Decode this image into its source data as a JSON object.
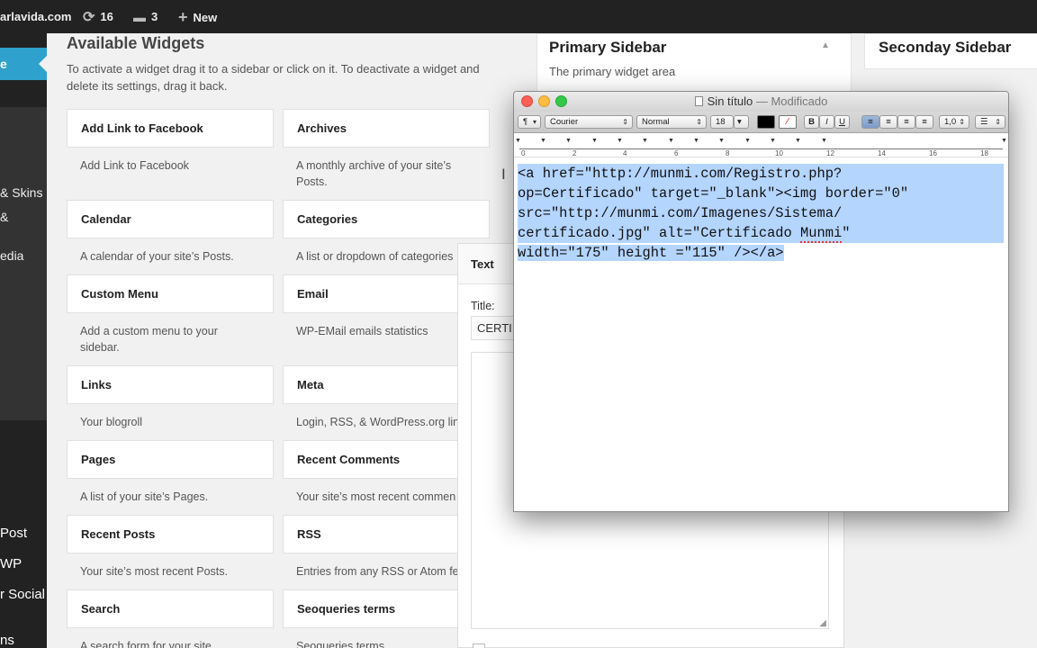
{
  "adminbar": {
    "site": "arlavida.com",
    "updates_count": "16",
    "comments_count": "3",
    "new_label": "New"
  },
  "leftmenu": {
    "current": "e",
    "items": [
      "& Skins",
      "&",
      "edia",
      "Post",
      "WP",
      "r Social",
      "ns"
    ]
  },
  "available": {
    "title": "Available Widgets",
    "description": "To activate a widget drag it to a sidebar or click on it. To deactivate a widget and delete its settings, drag it back."
  },
  "widgets": [
    {
      "name": "Add Link to Facebook",
      "desc": "Add Link to Facebook"
    },
    {
      "name": "Archives",
      "desc": "A monthly archive of your site’s Posts."
    },
    {
      "name": "Calendar",
      "desc": "A calendar of your site’s Posts."
    },
    {
      "name": "Categories",
      "desc": "A list or dropdown of categories"
    },
    {
      "name": "Custom Menu",
      "desc": "Add a custom menu to your sidebar."
    },
    {
      "name": "Email",
      "desc": "WP-EMail emails statistics"
    },
    {
      "name": "Links",
      "desc": "Your blogroll"
    },
    {
      "name": "Meta",
      "desc": "Login, RSS, & WordPress.org link"
    },
    {
      "name": "Pages",
      "desc": "A list of your site’s Pages."
    },
    {
      "name": "Recent Comments",
      "desc": "Your site’s most recent commen"
    },
    {
      "name": "Recent Posts",
      "desc": "Your site’s most recent Posts."
    },
    {
      "name": "RSS",
      "desc": "Entries from any RSS or Atom fe"
    },
    {
      "name": "Search",
      "desc": "A search form for your site"
    },
    {
      "name": "Seoqueries terms",
      "desc": "Seoqueries terms"
    }
  ],
  "primary_sidebar": {
    "title": "Primary Sidebar",
    "desc": "The primary widget area"
  },
  "secondary_sidebar": {
    "title": "Seconday Sidebar"
  },
  "text_widget": {
    "header": "Text",
    "title_label": "Title:",
    "title_value": "CERTI"
  },
  "textedit": {
    "title": "Sin título",
    "separator": " — ",
    "status": "Modificado",
    "toolbar": {
      "paragraph": "¶",
      "font": "Courier",
      "style": "Normal",
      "size": "18",
      "bold": "B",
      "italic": "I",
      "underline": "U",
      "line_spacing": "1,0"
    },
    "ruler_numbers": [
      "0",
      "2",
      "4",
      "6",
      "8",
      "10",
      "12",
      "14",
      "16",
      "18"
    ],
    "lines": [
      "<a href=\"http://munmi.com/Registro.php?",
      "op=Certificado\" target=\"_blank\"><img border=\"0\"",
      "src=\"http://munmi.com/Imagenes/Sistema/",
      "certificado.jpg\" alt=\"Certificado ",
      "Munmi",
      "\"",
      "width=\"175\" height =\"115\" /></a>"
    ]
  },
  "colors": {
    "adminbar_bg": "#222222",
    "accent": "#2ea2cc",
    "selection": "#b4d5fe"
  }
}
